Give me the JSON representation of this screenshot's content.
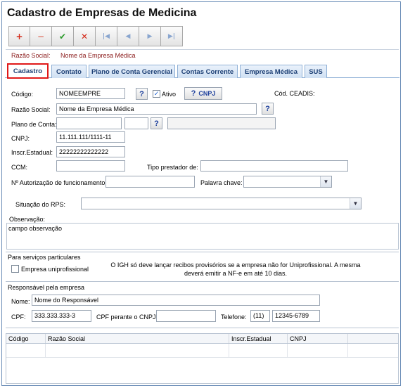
{
  "title": "Cadastro de Empresas de Medicina",
  "toolbar": {
    "add": "+",
    "remove": "−",
    "confirm": "✔",
    "cancel": "✕",
    "first": "|◀",
    "prev": "◀",
    "next": "▶",
    "last": "▶|"
  },
  "infobar": {
    "label": "Razão Social:",
    "value": "Nome da Empresa Médica"
  },
  "tabs": [
    "Cadastro",
    "Contato",
    "Plano de Conta Gerencial",
    "Contas Corrente",
    "Empresa Médica",
    "SUS"
  ],
  "form": {
    "codigo_label": "Código:",
    "codigo_value": "NOMEEMPRE",
    "ativo_label": "Ativo",
    "cnpj_button": "CNPJ",
    "ceadis_label": "Cód. CEADIS:",
    "razao_label": "Razão Social:",
    "razao_value": "Nome da  Empresa Médica",
    "plano_label": "Plano de Conta:",
    "cnpj_label": "CNPJ:",
    "cnpj_value": "11.111.111/1111-11",
    "inscr_label": "Inscr.Estadual:",
    "inscr_value": "22222222222222",
    "ccm_label": "CCM:",
    "tipo_label": "Tipo prestador de:",
    "autoriz_label": "Nº Autorização de funcionamento:",
    "palavra_label": "Palavra chave:",
    "rps_label": "Situação do RPS:",
    "obs_label": "Observação:",
    "obs_value": "campo observação"
  },
  "particulares": {
    "heading": "Para serviços particulares",
    "checkbox_label": "Empresa uniprofissional",
    "notice_line1": "O IGH só deve lançar recibos provisórios se a empresa não for Uniprofissional. A mesma",
    "notice_line2": "deverá emitir a NF-e em até 10 dias."
  },
  "responsavel": {
    "heading": "Responsável pela empresa",
    "nome_label": "Nome:",
    "nome_value": "Nome do Responsável",
    "cpf_label": "CPF:",
    "cpf_value": "333.333.333-3",
    "cpf_cnpj_label": "CPF perante o CNPJ:",
    "telefone_label": "Telefone:",
    "ddd_value": "(11)",
    "telefone_value": "12345-6789"
  },
  "grid": {
    "columns": [
      "Código",
      "Razão Social",
      "Inscr.Estadual",
      "CNPJ"
    ]
  },
  "colors": {
    "tab_text": "#1c3f75",
    "active_outline": "#e01818",
    "infobar_text": "#8a1a1a"
  }
}
